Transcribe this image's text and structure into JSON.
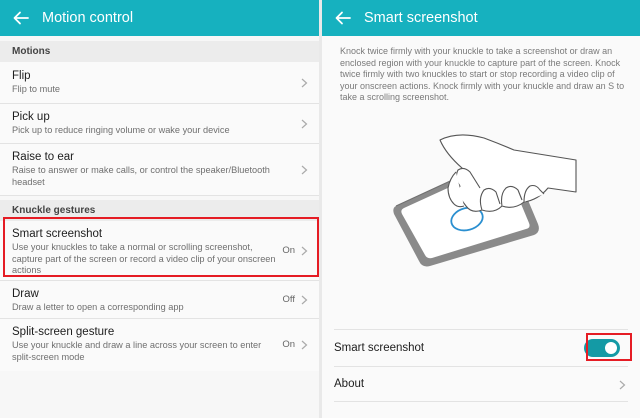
{
  "left": {
    "title": "Motion control",
    "sections": [
      {
        "header": "Motions",
        "items": [
          {
            "title": "Flip",
            "subtitle": "Flip to mute"
          },
          {
            "title": "Pick up",
            "subtitle": "Pick up to reduce ringing volume or wake your device"
          },
          {
            "title": "Raise to ear",
            "subtitle": "Raise to answer or make calls, or control the speaker/Bluetooth headset"
          }
        ]
      },
      {
        "header": "Knuckle gestures",
        "items": [
          {
            "title": "Smart screenshot",
            "subtitle": "Use your knuckles to take a normal or scrolling screenshot, capture part of the screen or record a video clip of your onscreen actions",
            "state": "On"
          },
          {
            "title": "Draw",
            "subtitle": "Draw a letter to open a corresponding app",
            "state": "Off"
          },
          {
            "title": "Split-screen gesture",
            "subtitle": "Use your knuckle and draw a line across your screen to enter split-screen mode",
            "state": "On"
          }
        ]
      }
    ]
  },
  "right": {
    "title": "Smart screenshot",
    "description": "Knock twice firmly with your knuckle to take a screenshot or draw an enclosed region with your knuckle to capture part of the screen. Knock twice firmly with two knuckles to start or stop recording a video clip of your onscreen actions. Knock firmly with your knuckle and draw an S to take a scrolling screenshot.",
    "toggle_label": "Smart screenshot",
    "toggle_on": true,
    "about_label": "About"
  },
  "colors": {
    "appbar": "#16b1bf",
    "toggle_on": "#149aa5",
    "highlight": "#e51c24",
    "illustration_circle": "#2a8fd0"
  },
  "icons": [
    "back-arrow-icon",
    "chevron-right-icon",
    "hand-phone-illustration"
  ]
}
